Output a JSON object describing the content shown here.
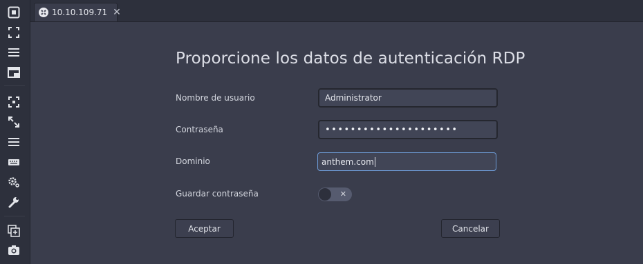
{
  "sidebar": {
    "icons": [
      {
        "name": "full-screen-icon"
      },
      {
        "name": "fit-window-icon"
      },
      {
        "name": "menu-icon"
      },
      {
        "name": "window-icon"
      },
      {
        "name": "select-area-icon"
      },
      {
        "name": "expand-icon"
      },
      {
        "name": "list-icon"
      },
      {
        "name": "keyboard-icon"
      },
      {
        "name": "settings-icon"
      },
      {
        "name": "wrench-icon"
      },
      {
        "name": "add-window-icon"
      },
      {
        "name": "camera-icon"
      }
    ]
  },
  "tab": {
    "label": "10.10.109.71",
    "close": "✕"
  },
  "dialog": {
    "title": "Proporcione los datos de autenticación RDP",
    "username_label": "Nombre de usuario",
    "username_value": "Administrator",
    "password_label": "Contraseña",
    "password_value": "•••••••••••••••••••••",
    "domain_label": "Dominio",
    "domain_value": "anthem.com",
    "save_password_label": "Guardar contraseña",
    "save_password_toggle": "✕",
    "accept_label": "Aceptar",
    "cancel_label": "Cancelar"
  },
  "colors": {
    "background": "#3a3d4c",
    "sidebar": "#2d303c",
    "input": "#414556",
    "focus": "#6d9bd6"
  }
}
